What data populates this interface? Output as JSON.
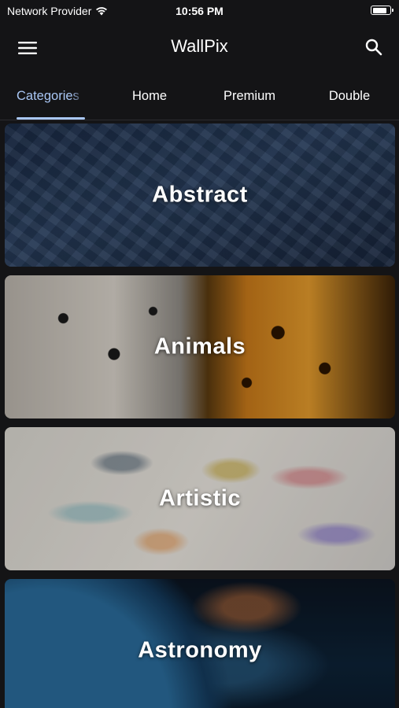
{
  "status_bar": {
    "carrier": "Network Provider",
    "time": "10:56 PM",
    "battery_level": 0.85
  },
  "app_bar": {
    "title": "WallPix",
    "menu_icon": "menu-icon",
    "search_icon": "search-icon"
  },
  "tabs": [
    {
      "label": "Categories",
      "active": true
    },
    {
      "label": "Home",
      "active": false
    },
    {
      "label": "Premium",
      "active": false
    },
    {
      "label": "Double",
      "active": false
    }
  ],
  "categories": [
    {
      "label": "Abstract"
    },
    {
      "label": "Animals"
    },
    {
      "label": "Artistic"
    },
    {
      "label": "Astronomy"
    }
  ],
  "colors": {
    "background": "#141416",
    "accent": "#a9c7f5",
    "text": "#ffffff"
  }
}
